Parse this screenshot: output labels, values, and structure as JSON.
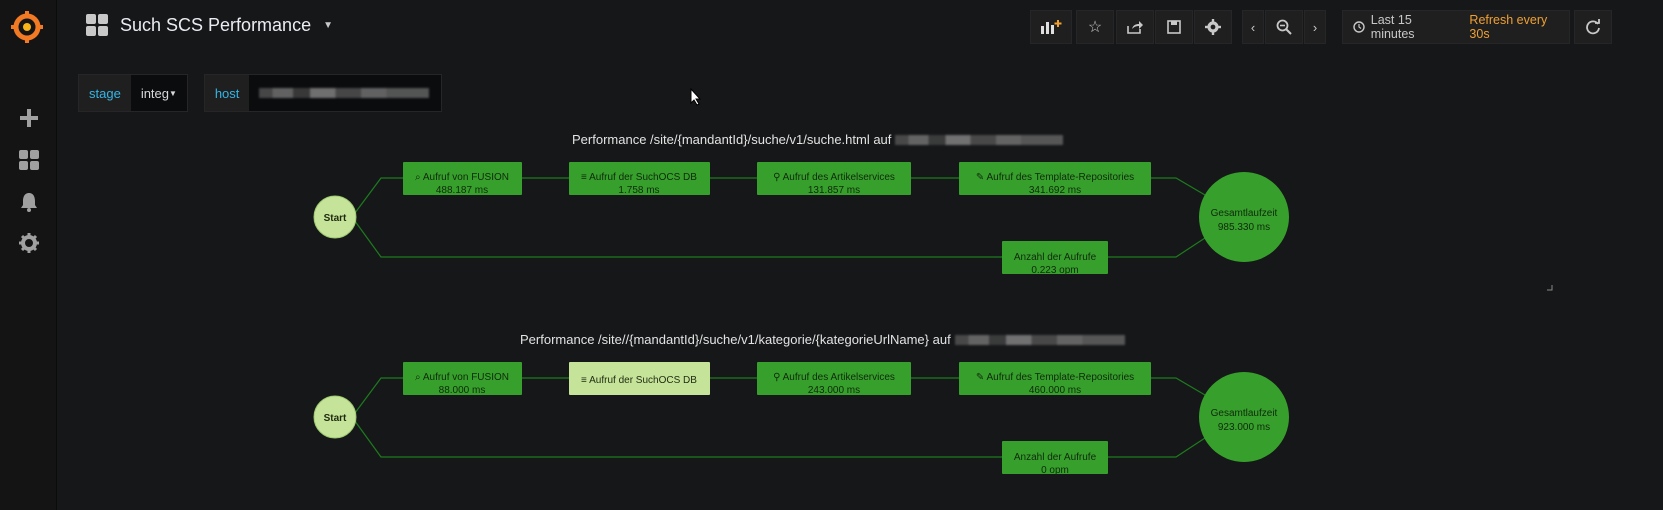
{
  "nav": {
    "dashboard_title": "Such SCS Performance",
    "time_range": "Last 15 minutes",
    "refresh": "Refresh every 30s"
  },
  "variables": [
    {
      "label": "stage",
      "value": "integ"
    },
    {
      "label": "host",
      "value": ""
    }
  ],
  "panels": [
    {
      "title": "Performance /site/{mandantId}/suche/v1/suche.html auf",
      "start": "Start",
      "nodes": [
        {
          "label": "Aufruf von FUSION",
          "value": "488.187 ms",
          "icon": "search-icon"
        },
        {
          "label": "Aufruf der SuchOCS DB",
          "value": "1.758 ms",
          "icon": "database-icon"
        },
        {
          "label": "Aufruf des Artikelservices",
          "value": "131.857 ms",
          "icon": "sitemap-icon"
        },
        {
          "label": "Aufruf des Template-Repositories",
          "value": "341.692 ms",
          "icon": "brush-icon"
        }
      ],
      "count": {
        "label": "Anzahl der Aufrufe",
        "value": "0.223 opm"
      },
      "total": {
        "label": "Gesamtlaufzeit",
        "value": "985.330 ms"
      }
    },
    {
      "title": "Performance /site//{mandantId}/suche/v1/kategorie/{kategorieUrlName} auf",
      "start": "Start",
      "nodes": [
        {
          "label": "Aufruf von FUSION",
          "value": "88.000 ms",
          "icon": "search-icon"
        },
        {
          "label": "Aufruf der SuchOCS DB",
          "value": "",
          "icon": "database-icon"
        },
        {
          "label": "Aufruf des Artikelservices",
          "value": "243.000 ms",
          "icon": "sitemap-icon"
        },
        {
          "label": "Aufruf des Template-Repositories",
          "value": "460.000 ms",
          "icon": "brush-icon"
        }
      ],
      "count": {
        "label": "Anzahl der Aufrufe",
        "value": "0 opm"
      },
      "total": {
        "label": "Gesamtlaufzeit",
        "value": "923.000 ms"
      }
    }
  ],
  "colors": {
    "node_green": "#37a02c",
    "node_light": "#c5e49a",
    "edge": "#1d7c1d",
    "accent": "#f0a030"
  }
}
